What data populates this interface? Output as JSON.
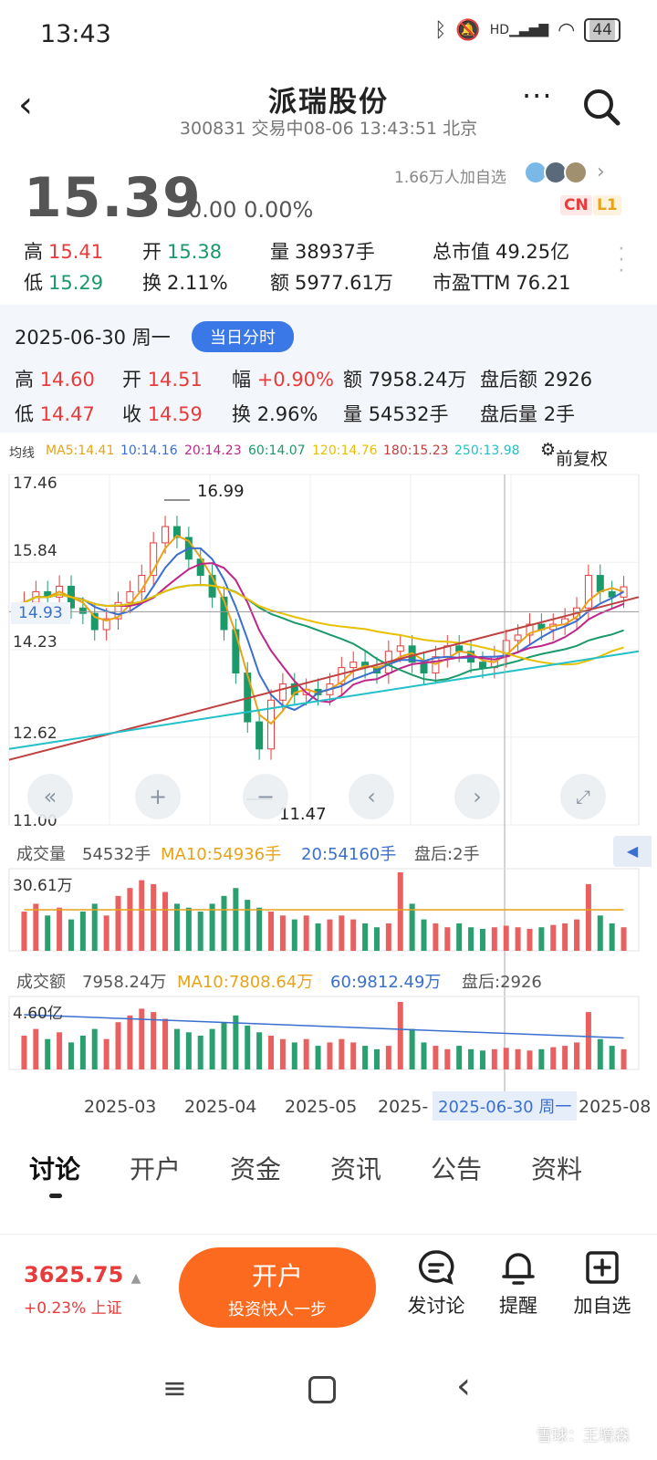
{
  "status": {
    "time": "13:43",
    "battery": "44",
    "net": "HD"
  },
  "nav": {
    "title": "派瑞股份",
    "subtitle": "300831 交易中08-06 13:43:51 北京"
  },
  "quote": {
    "price": "15.39",
    "change": "0.00 0.00%",
    "followers": "1.66万人加自选",
    "tag_cn": "CN",
    "tag_l1": "L1",
    "high_label": "高",
    "high": "15.41",
    "open_label": "开",
    "open": "15.38",
    "vol_label": "量",
    "vol": "38937手",
    "mcap_label": "总市值",
    "mcap": "49.25亿",
    "low_label": "低",
    "low": "15.29",
    "turn_label": "换",
    "turn": "2.11%",
    "amt_label": "额",
    "amt": "5977.61万",
    "pe_label": "市盈TTM",
    "pe": "76.21"
  },
  "hist": {
    "date": "2025-06-30 周一",
    "button": "当日分时",
    "high_label": "高",
    "high": "14.60",
    "open_label": "开",
    "open": "14.51",
    "amp_label": "幅",
    "amp": "+0.90%",
    "amt_label": "额",
    "amt": "7958.24万",
    "after_amt_label": "盘后额",
    "after_amt": "2926",
    "low_label": "低",
    "low": "14.47",
    "close_label": "收",
    "close": "14.59",
    "turn_label": "换",
    "turn": "2.96%",
    "vol_label": "量",
    "vol": "54532手",
    "after_vol_label": "盘后量",
    "after_vol": "2手"
  },
  "ma": {
    "label": "均线",
    "ma5": "MA5:14.41",
    "ma10": "10:14.16",
    "ma20": "20:14.23",
    "ma60": "60:14.07",
    "ma120": "120:14.76",
    "ma180": "180:15.23",
    "ma250": "250:13.98",
    "adjust": "前复权",
    "colors": {
      "ma5": "#e8a317",
      "ma10": "#3a6fd0",
      "ma20": "#c0268a",
      "ma60": "#1a9a6a",
      "ma120": "#e8c000",
      "ma180": "#c04040",
      "ma250": "#22c0c8"
    }
  },
  "chart": {
    "y_labels": [
      "17.46",
      "15.84",
      "14.23",
      "12.62",
      "11.00"
    ],
    "crosshair_price": "14.93",
    "max_label": "16.99",
    "min_label": "11.47",
    "vol_title": "成交量",
    "vol_value": "54532手",
    "vol_ma10": "MA10:54936手",
    "vol_ma20": "20:54160手",
    "vol_after": "盘后:2手",
    "vol_max": "30.61万",
    "amt_title": "成交额",
    "amt_value": "7958.24万",
    "amt_ma10": "MA10:7808.64万",
    "amt_ma60": "60:9812.49万",
    "amt_after": "盘后:2926",
    "amt_max": "4.60亿",
    "x_labels": [
      "2025-03",
      "2025-04",
      "2025-05",
      "2025-",
      "2025-08"
    ],
    "crosshair_date": "2025-06-30 周一"
  },
  "chart_data": {
    "type": "candlestick",
    "title": "",
    "ylim": [
      11.0,
      17.46
    ],
    "y_ticks": [
      17.46,
      15.84,
      14.23,
      12.62,
      11.0
    ],
    "max": 16.99,
    "min": 11.47,
    "x_ticks": [
      "2025-03",
      "2025-04",
      "2025-05",
      "2025-06",
      "2025-07",
      "2025-08"
    ],
    "close_series": [
      15.1,
      15.3,
      15.2,
      15.4,
      15.0,
      14.9,
      14.6,
      14.8,
      15.1,
      15.3,
      15.6,
      16.2,
      16.5,
      16.3,
      15.9,
      15.6,
      15.2,
      14.6,
      13.8,
      12.9,
      12.4,
      13.3,
      13.6,
      13.4,
      13.5,
      13.4,
      13.6,
      13.9,
      14.0,
      13.9,
      13.8,
      14.2,
      14.3,
      14.0,
      13.8,
      14.1,
      14.3,
      14.2,
      14.0,
      13.9,
      14.1,
      14.4,
      14.5,
      14.7,
      14.6,
      14.7,
      14.8,
      15.0,
      15.6,
      15.3,
      15.2,
      15.39
    ]
  },
  "tabs": [
    "讨论",
    "开户",
    "资金",
    "资讯",
    "公告",
    "资料"
  ],
  "bottom": {
    "index": "3625.75",
    "index_sub": "+0.23% 上证",
    "open_a": "开户",
    "open_b": "投资快人一步",
    "act1": "发讨论",
    "act2": "提醒",
    "act3": "加自选"
  },
  "watermark": "雪球：王增森"
}
